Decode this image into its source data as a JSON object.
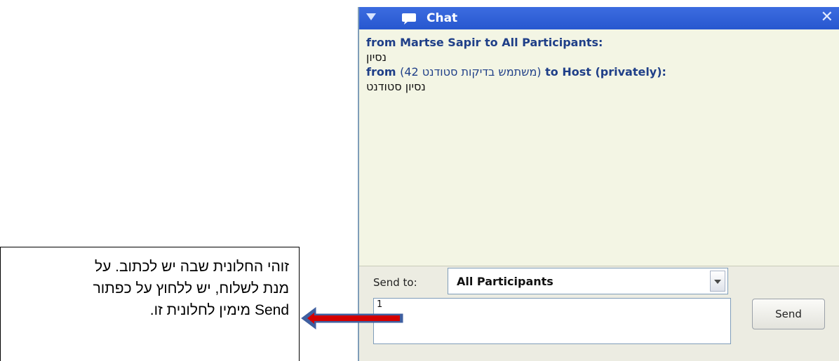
{
  "chat": {
    "title": "Chat",
    "messages": [
      {
        "header_prefix": "from Martse Sapir to All Participants:",
        "header_rtl": "",
        "header_suffix": "",
        "body": "נסיון"
      },
      {
        "header_prefix": "from ",
        "header_rtl": "(משתמש בדיקות סטודנט 42)",
        "header_suffix": " to Host (privately):",
        "body": "נסיון סטודנט"
      }
    ],
    "compose": {
      "send_to_label": "Send to:",
      "send_to_value": "All Participants",
      "input_value": "1",
      "send_label": "Send"
    }
  },
  "annotation": {
    "lines": [
      "זוהי החלונית שבה יש לכתוב. על",
      "מנת לשלוח, יש ללחוץ על כפתור",
      "Send מימין לחלונית זו."
    ]
  },
  "icons": {
    "collapse": "triangle-down-icon",
    "chat": "chat-bubble-icon",
    "close": "close-icon",
    "dropdown": "chevron-down-icon",
    "pointer": "arrow-left-icon"
  },
  "colors": {
    "title_bar": "#2f60d6",
    "header_text": "#1f3f88",
    "panel_bg": "#f3f5e4",
    "arrow_fill": "#d40000",
    "arrow_outline": "#3f5fa0"
  }
}
